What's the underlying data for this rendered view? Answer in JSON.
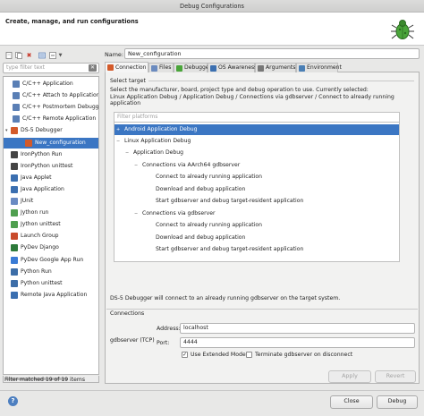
{
  "window": {
    "title": "Debug Configurations"
  },
  "header": {
    "title": "Create, manage, and run configurations"
  },
  "left": {
    "filter_placeholder": "type filter text",
    "status": "Filter matched 19 of 19 items",
    "items": [
      {
        "label": "C/C++ Application",
        "icon": "c-app-icon",
        "color": "#5a7fb5"
      },
      {
        "label": "C/C++ Attach to Application",
        "icon": "c-attach-icon",
        "color": "#5a7fb5"
      },
      {
        "label": "C/C++ Postmortem Debugger",
        "icon": "c-postmortem-icon",
        "color": "#5a7fb5"
      },
      {
        "label": "C/C++ Remote Application",
        "icon": "c-remote-icon",
        "color": "#5a7fb5"
      },
      {
        "label": "DS-5 Debugger",
        "icon": "ds5-icon",
        "color": "#d35a2a"
      },
      {
        "label": "New_configuration",
        "icon": "config-icon",
        "color": "#d35a2a"
      },
      {
        "label": "IronPython Run",
        "icon": "ironpython-icon",
        "color": "#444444"
      },
      {
        "label": "IronPython unittest",
        "icon": "ironpython-unittest-icon",
        "color": "#444444"
      },
      {
        "label": "Java Applet",
        "icon": "java-applet-icon",
        "color": "#3b6fb0"
      },
      {
        "label": "Java Application",
        "icon": "java-app-icon",
        "color": "#3b6fb0"
      },
      {
        "label": "JUnit",
        "icon": "junit-icon",
        "color": "#6a8bc3"
      },
      {
        "label": "Jython run",
        "icon": "jython-icon",
        "color": "#4f9f4f"
      },
      {
        "label": "Jython unittest",
        "icon": "jython-unittest-icon",
        "color": "#4f9f4f"
      },
      {
        "label": "Launch Group",
        "icon": "launch-group-icon",
        "color": "#c94b2c"
      },
      {
        "label": "PyDev Django",
        "icon": "django-icon",
        "color": "#2d7a3a"
      },
      {
        "label": "PyDev Google App Run",
        "icon": "google-app-icon",
        "color": "#3a7bd5"
      },
      {
        "label": "Python Run",
        "icon": "python-icon",
        "color": "#3d6ea8"
      },
      {
        "label": "Python unittest",
        "icon": "python-unittest-icon",
        "color": "#3d6ea8"
      },
      {
        "label": "Remote Java Application",
        "icon": "remote-java-icon",
        "color": "#3b6fb0"
      }
    ]
  },
  "config": {
    "name_label": "Name:",
    "name_value": "New_configuration",
    "tabs": [
      {
        "label": "Connection",
        "icon": "connection-icon"
      },
      {
        "label": "Files",
        "icon": "files-icon"
      },
      {
        "label": "Debugger",
        "icon": "debugger-icon"
      },
      {
        "label": "OS Awareness",
        "icon": "os-icon"
      },
      {
        "label": "Arguments",
        "icon": "arguments-icon"
      },
      {
        "label": "Environment",
        "icon": "environment-icon"
      }
    ],
    "target": {
      "group_label": "Select target",
      "desc_line1": "Select the manufacturer, board, project type and debug operation to use. Currently selected:",
      "desc_line2": "Linux Application Debug / Application Debug / Connections via gdbserver / Connect to already running application",
      "filter_placeholder": "Filter platforms",
      "tree": [
        {
          "label": "Android Application Debug",
          "twisty": "+"
        },
        {
          "label": "Linux Application Debug",
          "twisty": "−"
        },
        {
          "label": "Application Debug",
          "twisty": "−"
        },
        {
          "label": "Connections via AArch64 gdbserver",
          "twisty": "−"
        },
        {
          "label": "Connect to already running application",
          "twisty": ""
        },
        {
          "label": "Download and debug application",
          "twisty": ""
        },
        {
          "label": "Start gdbserver and debug target-resident application",
          "twisty": ""
        },
        {
          "label": "Connections via gdbserver",
          "twisty": "−"
        },
        {
          "label": "Connect to already running application",
          "twisty": ""
        },
        {
          "label": "Download and debug application",
          "twisty": ""
        },
        {
          "label": "Start gdbserver and debug target-resident application",
          "twisty": ""
        }
      ],
      "status": "DS-5 Debugger will connect to an already running gdbserver on the target system."
    },
    "connections": {
      "group_label": "Connections",
      "gdbserver_label": "gdbserver (TCP)",
      "address_label": "Address:",
      "address_value": "localhost",
      "port_label": "Port:",
      "port_value": "4444",
      "use_extended_label": "Use Extended Mode",
      "terminate_label": "Terminate gdbserver on disconnect"
    }
  },
  "buttons": {
    "apply": "Apply",
    "revert": "Revert",
    "close": "Close",
    "debug": "Debug",
    "help": "?"
  }
}
